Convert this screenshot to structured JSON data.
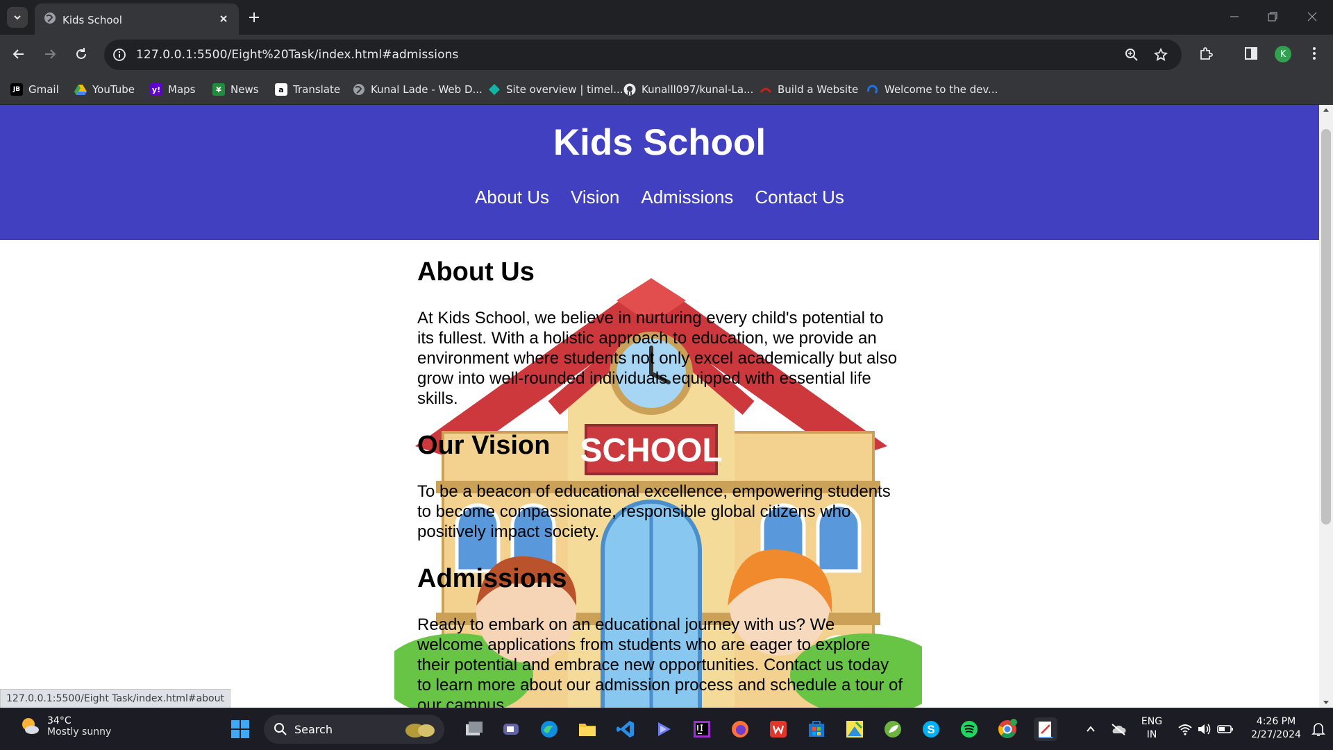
{
  "browser": {
    "tab_title": "Kids School",
    "url": "127.0.0.1:5500/Eight%20Task/index.html#admissions",
    "status_url": "127.0.0.1:5500/Eight Task/index.html#about",
    "profile_initial": "K",
    "bookmarks": [
      {
        "label": "Gmail",
        "icon": "jetbrains-icon"
      },
      {
        "label": "YouTube",
        "icon": "drive-icon"
      },
      {
        "label": "Maps",
        "icon": "yahoo-icon"
      },
      {
        "label": "News",
        "icon": "news-icon"
      },
      {
        "label": "Translate",
        "icon": "amazon-icon"
      },
      {
        "label": "Kunal Lade - Web D...",
        "icon": "globe-icon"
      },
      {
        "label": "Site overview | timel...",
        "icon": "diamond-icon"
      },
      {
        "label": "Kunalll097/kunal-La...",
        "icon": "github-icon"
      },
      {
        "label": "Build a Website",
        "icon": "website-icon"
      },
      {
        "label": "Welcome to the dev...",
        "icon": "swirl-icon"
      }
    ]
  },
  "site": {
    "title": "Kids School",
    "nav": [
      "About Us",
      "Vision",
      "Admissions",
      "Contact Us"
    ],
    "about": {
      "heading": "About Us",
      "text": "At Kids School, we believe in nurturing every child's potential to its fullest. With a holistic approach to education, we provide an environment where students not only excel academically but also grow into well-rounded individuals equipped with essential life skills."
    },
    "vision": {
      "heading": "Our Vision",
      "text": "To be a beacon of educational excellence, empowering students to become compassionate, responsible global citizens who positively impact society."
    },
    "admissions": {
      "heading": "Admissions",
      "text": "Ready to embark on an educational journey with us? We welcome applications from students who are eager to explore their potential and embrace new opportunities. Contact us today to learn more about our admission process and schedule a tour of our campus."
    },
    "image_sign": "SCHOOL"
  },
  "taskbar": {
    "weather_temp": "34°C",
    "weather_desc": "Mostly sunny",
    "search_label": "Search",
    "lang_line1": "ENG",
    "lang_line2": "IN",
    "time": "4:26 PM",
    "date": "2/27/2024"
  }
}
